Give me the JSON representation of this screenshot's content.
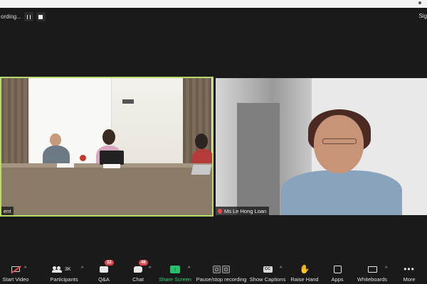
{
  "recording": {
    "status_text": "ording...",
    "pause_icon": "pause-icon",
    "stop_icon": "stop-icon"
  },
  "top_right_text": "Sig",
  "tiles": [
    {
      "name_label": "ent",
      "active_speaker": true
    },
    {
      "name_label": "Ms Le Hong Loan",
      "muted": true
    }
  ],
  "toolbar": {
    "start_video": "Start Video",
    "participants": "Participants",
    "participants_count": "3K",
    "qa": "Q&A",
    "qa_badge": "32",
    "chat": "Chat",
    "chat_badge": "48",
    "share_screen": "Share Screen",
    "pause_stop_recording": "Pause/stop recording",
    "show_captions": "Show Captions",
    "cc_icon_text": "CC",
    "raise_hand": "Raise Hand",
    "apps": "Apps",
    "whiteboards": "Whiteboards",
    "more": "More"
  },
  "colors": {
    "active_border": "#b9d96a",
    "share_accent": "#23c16b",
    "badge": "#e0464c"
  }
}
